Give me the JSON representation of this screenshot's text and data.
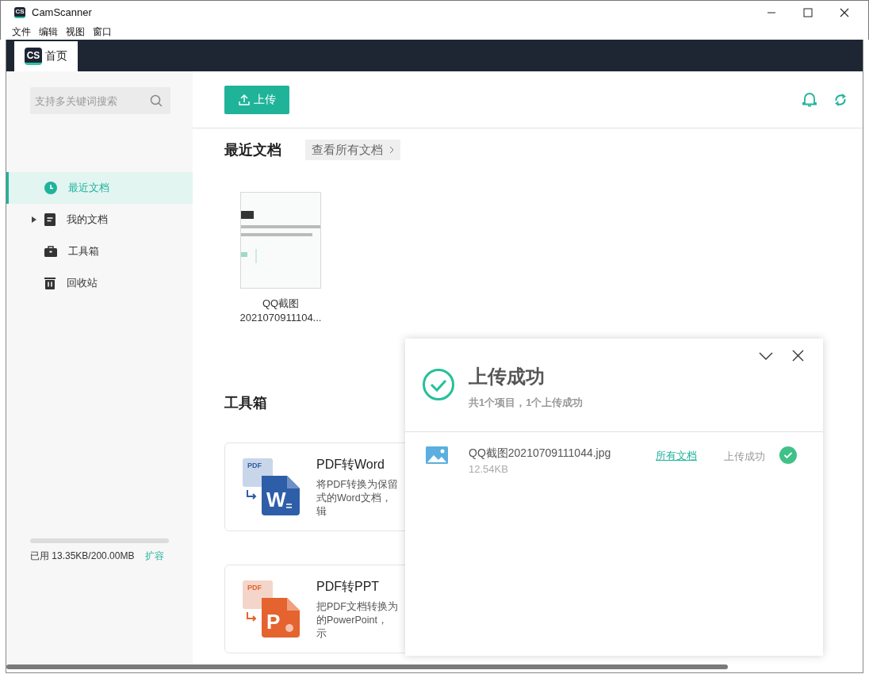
{
  "app": {
    "logo": "CS",
    "title": "CamScanner"
  },
  "menu": [
    "文件",
    "编辑",
    "视图",
    "窗口"
  ],
  "tabs": [
    {
      "logo": "CS",
      "label": "首页",
      "selected": true
    }
  ],
  "sidebar": {
    "search": {
      "placeholder": "支持多关键词搜索"
    },
    "items": [
      {
        "kind": "clock",
        "label": "最近文档",
        "selected": true
      },
      {
        "kind": "doc",
        "label": "我的文档",
        "selected": false,
        "expanded": false
      },
      {
        "kind": "toolbox",
        "label": "工具箱",
        "selected": false
      },
      {
        "kind": "trash",
        "label": "回收站",
        "selected": false
      }
    ],
    "storage": {
      "level": 0,
      "text": "已用 13.35KB/200.00MB",
      "action": "扩容"
    }
  },
  "toolbar": {
    "upload": "上传"
  },
  "recent": {
    "title": "最近文档",
    "view_all": "查看所有文档",
    "docs": [
      {
        "kind": "picture",
        "name_lines": [
          "QQ截图",
          "2021070911104..."
        ]
      }
    ]
  },
  "tools": {
    "title": "工具箱",
    "cards": [
      {
        "kind": "word",
        "badge": "PDF",
        "letter": "W",
        "title": "PDF转Word",
        "desc_lines": [
          "将PDF转换为保留",
          "式的Word文档，",
          "辑"
        ]
      },
      {
        "kind": "ppt",
        "badge": "PDF",
        "letter": "P",
        "title": "PDF转PPT",
        "desc_lines": [
          "把PDF文档转换为",
          "的PowerPoint，",
          "示"
        ]
      }
    ]
  },
  "upload_panel": {
    "title": "上传成功",
    "summary": "共1个项目，1个上传成功",
    "files": [
      {
        "name": "QQ截图20210709111044.jpg",
        "size": "12.54KB",
        "link": "所有文档",
        "status": "上传成功"
      }
    ]
  }
}
